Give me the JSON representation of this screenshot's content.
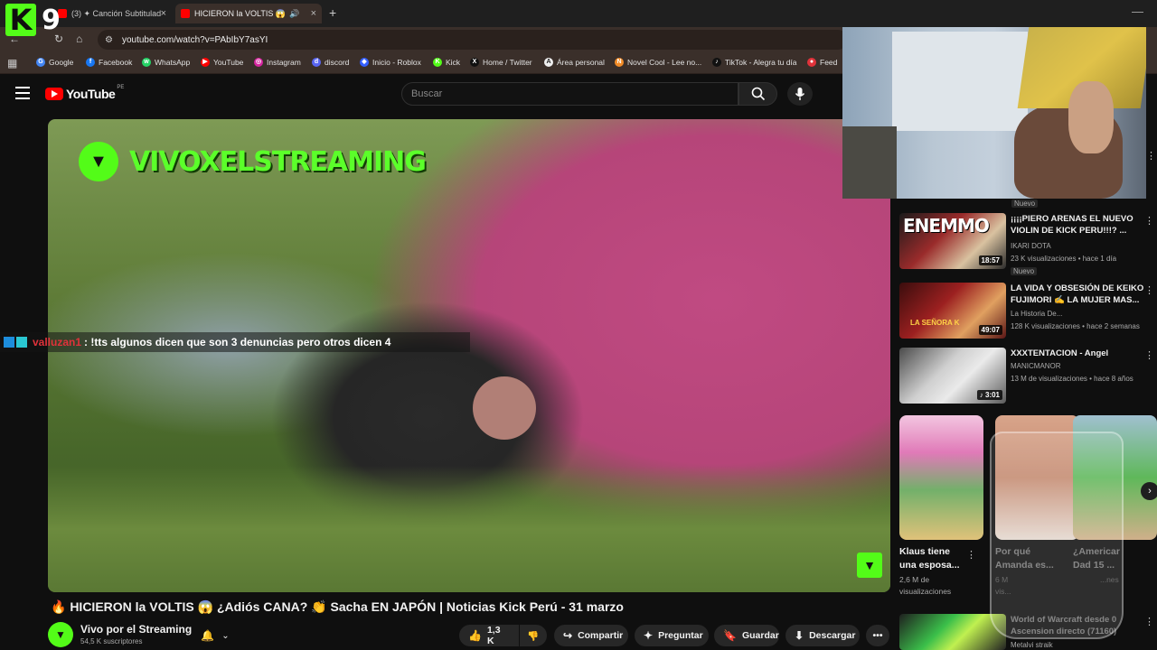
{
  "browser": {
    "tabs": [
      {
        "title": "(3) ✦ Canción Subtitulada c",
        "close": "×",
        "active": false
      },
      {
        "title": "HICIERON la VOLTIS 😱",
        "close": "×",
        "active": true
      }
    ],
    "new_tab": "+",
    "minimize": "—",
    "url": "youtube.com/watch?v=PAbIbY7asYI",
    "bookmarks": [
      {
        "label": "Google",
        "color": "#4285f4",
        "glyph": "G"
      },
      {
        "label": "Facebook",
        "color": "#1877f2",
        "glyph": "f"
      },
      {
        "label": "WhatsApp",
        "color": "#25d366",
        "glyph": "w"
      },
      {
        "label": "YouTube",
        "color": "#ff0000",
        "glyph": "▶"
      },
      {
        "label": "Instagram",
        "color": "#d6249f",
        "glyph": "◎"
      },
      {
        "label": "discord",
        "color": "#5865f2",
        "glyph": "d"
      },
      {
        "label": "Inicio - Roblox",
        "color": "#335fff",
        "glyph": "◆"
      },
      {
        "label": "Kick",
        "color": "#53fc18",
        "glyph": "K"
      },
      {
        "label": "Home / Twitter",
        "color": "#111111",
        "glyph": "X"
      },
      {
        "label": "Área personal",
        "color": "#eeeeee",
        "glyph": "A"
      },
      {
        "label": "Novel Cool - Lee no...",
        "color": "#f28c28",
        "glyph": "N"
      },
      {
        "label": "TikTok - Alegra tu día",
        "color": "#111111",
        "glyph": "♪"
      },
      {
        "label": "Feed",
        "color": "#e0323a",
        "glyph": "●"
      }
    ]
  },
  "overlay": {
    "k9_letter": "K",
    "k9_number": "9",
    "chat_user": "valluzan1",
    "chat_message": ": !tts algunos dicen que son 3 denuncias pero otros dicen 4"
  },
  "youtube": {
    "logo_text": "YouTube",
    "country_code": "PE",
    "search_placeholder": "Buscar"
  },
  "video": {
    "watermark_text": "VIVOXELSTREAMING",
    "title": "🔥 HICIERON la VOLTIS 😱 ¿Adiós CANA? 👏 Sacha EN JAPÓN | Noticias Kick Perú - 31 marzo",
    "channel_name": "Vivo por el Streaming",
    "subscribers": "54,5 K suscriptores",
    "actions": {
      "likes": "1,3 K",
      "share": "Compartir",
      "ask": "Preguntar",
      "save": "Guardar",
      "download": "Descargar",
      "more": "•••"
    }
  },
  "sidebar": {
    "top_badge": "Nuevo",
    "recommendations": [
      {
        "title": "¡¡¡¡PIERO ARENAS EL NUEVO VIOLIN DE KICK PERU!!!? ...",
        "channel": "IKARI DOTA",
        "meta": "23 K visualizaciones • hace 1 día",
        "badge": "Nuevo",
        "duration": "18:57",
        "thumb_text": "ENEMMO"
      },
      {
        "title": "LA VIDA Y OBSESIÓN DE KEIKO FUJIMORI ✍️ LA MUJER MAS...",
        "channel": "La Historia De...",
        "meta": "128 K visualizaciones • hace 2 semanas",
        "badge": "",
        "duration": "49:07",
        "thumb_text": "LA SEÑORA K"
      },
      {
        "title": "XXXTENTACION - Angel",
        "channel": "MANICMANOR",
        "meta": "13 M de visualizaciones • hace 8 años",
        "badge": "",
        "duration": "♪ 3:01",
        "thumb_text": ""
      }
    ],
    "shorts": [
      {
        "title_line1": "Klaus tiene",
        "title_line2": "una esposa...",
        "views_line1": "2,6 M de",
        "views_line2": "visualizaciones"
      },
      {
        "title_line1": "Por qué",
        "title_line2": "Amanda es...",
        "views_line1": "6 M",
        "views_line2": "vis..."
      },
      {
        "title_line1": "¿Americar",
        "title_line2": "Dad 15 ...",
        "views_line1": "",
        "views_line2": "...nes"
      }
    ],
    "shorts_next": "›",
    "last_rec": {
      "title_line1": "World of Warcraft desde 0",
      "title_line2": "Ascension directo (71160)",
      "channel": "Metalvi straik"
    }
  }
}
